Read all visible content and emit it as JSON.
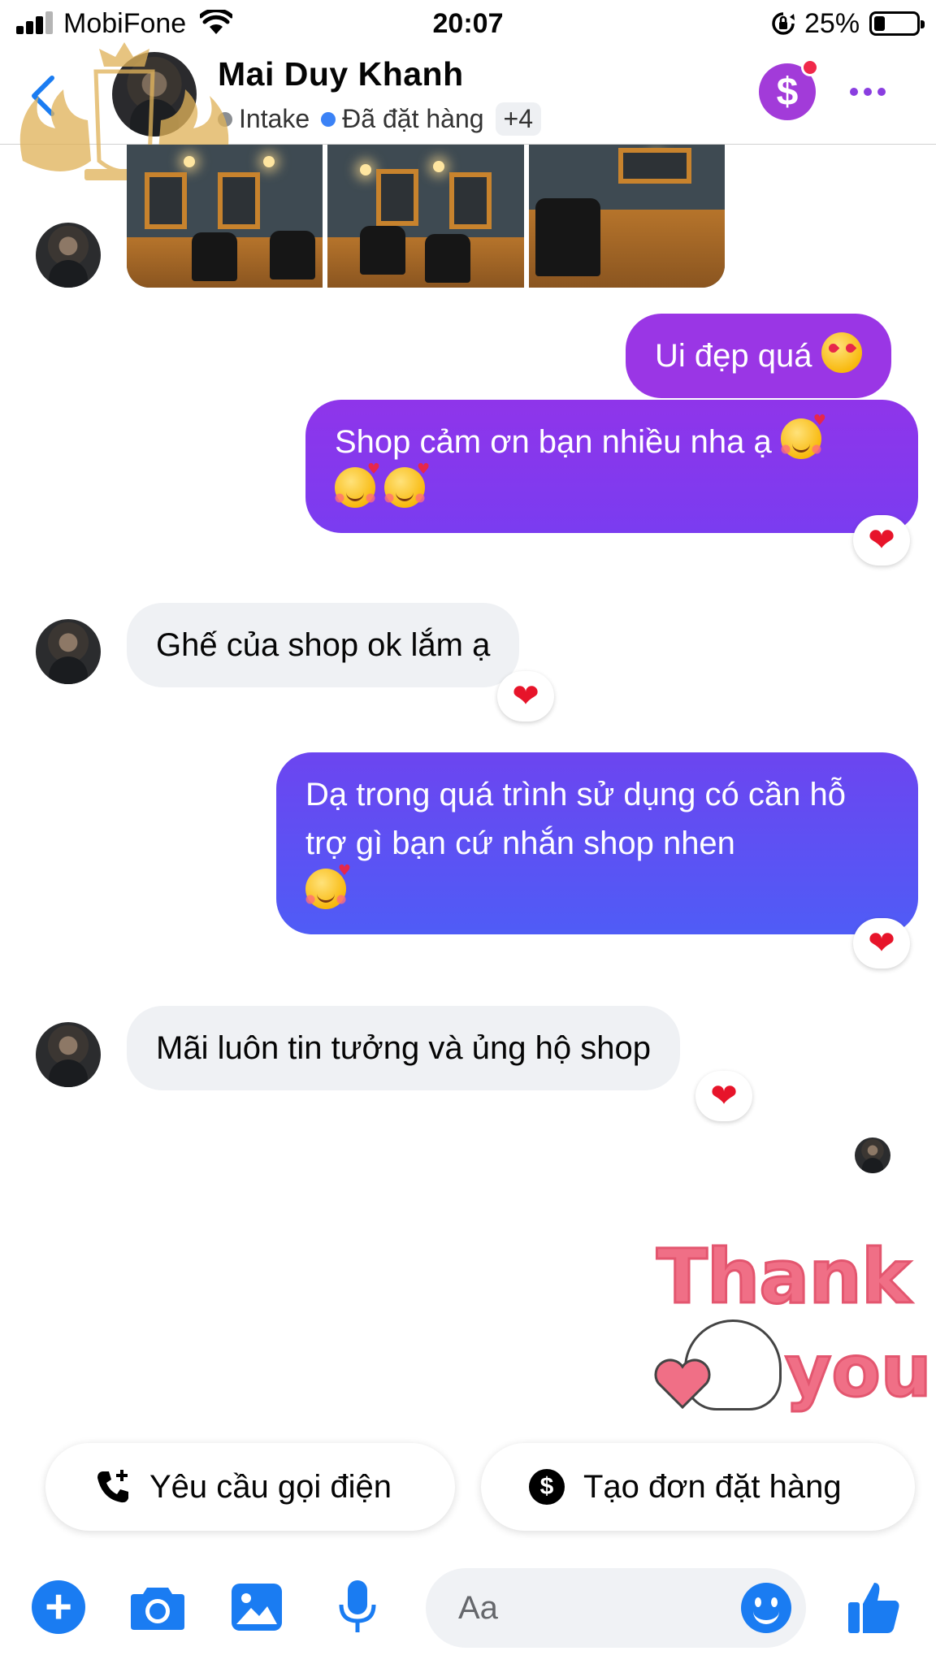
{
  "status_bar": {
    "carrier": "MobiFone",
    "time": "20:07",
    "battery_percent": "25%",
    "battery_level": 0.25
  },
  "header": {
    "contact_name": "Mai Duy Khanh",
    "labels": [
      {
        "text": "Intake",
        "color": "#8a8d91"
      },
      {
        "text": "Đã đặt hàng",
        "color": "#3b82f6"
      }
    ],
    "more_labels": "+4",
    "accent": "#8a3ee0",
    "icons": {
      "back": "chevron-left-icon",
      "payment": "dollar-icon",
      "more": "more-dots-icon"
    }
  },
  "messages": [
    {
      "id": "m1",
      "direction": "outgoing",
      "text": "Ui đẹp quá",
      "emoji": "heart-eyes"
    },
    {
      "id": "m2",
      "direction": "outgoing",
      "text": "Shop cảm ơn bạn nhiều nha ạ",
      "emoji": "smiling-face-with-hearts",
      "reaction": "❤"
    },
    {
      "id": "m3",
      "direction": "incoming",
      "text": "Ghế của shop ok lắm ạ",
      "reaction": "❤"
    },
    {
      "id": "m4",
      "direction": "outgoing",
      "text": "Dạ trong quá trình sử dụng có cần hỗ trợ gì bạn cứ nhắn shop nhen",
      "emoji": "smiling-face-with-hearts",
      "reaction": "❤"
    },
    {
      "id": "m5",
      "direction": "incoming",
      "text": "Mãi luôn tin tưởng và ủng hộ shop",
      "reaction": "❤"
    }
  ],
  "sticker": {
    "line1": "Thank",
    "line2": "you"
  },
  "quick_actions": {
    "call": {
      "label": "Yêu cầu gọi điện",
      "icon": "phone-plus-icon"
    },
    "order": {
      "label": "Tạo đơn đặt hàng",
      "icon": "dollar-circle-icon"
    }
  },
  "composer": {
    "placeholder": "Aa",
    "icons": [
      "plus-icon",
      "camera-icon",
      "image-icon",
      "microphone-icon",
      "emoji-icon",
      "thumbs-up-icon"
    ]
  },
  "colors": {
    "outgoing_top": "#9b2fe6",
    "outgoing_bottom": "#4b5cf5",
    "incoming_bg": "#eff1f4",
    "messenger_blue": "#1a7cf2",
    "reaction_heart": "#e7142a"
  }
}
